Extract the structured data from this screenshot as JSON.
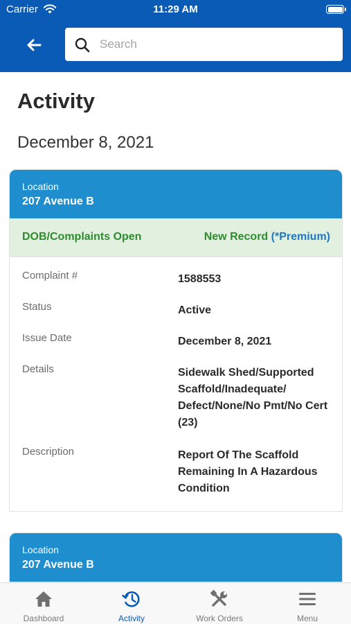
{
  "status_bar": {
    "carrier": "Carrier",
    "time": "11:29 AM"
  },
  "search": {
    "placeholder": "Search",
    "value": ""
  },
  "page": {
    "title": "Activity",
    "date": "December 8, 2021"
  },
  "cards": [
    {
      "location_label": "Location",
      "location": "207 Avenue B",
      "status_left": "DOB/Complaints Open",
      "status_right": "New Record",
      "premium": "(*Premium)",
      "fields": [
        {
          "label": "Complaint #",
          "value": "1588553"
        },
        {
          "label": "Status",
          "value": "Active"
        },
        {
          "label": "Issue Date",
          "value": "December 8, 2021"
        },
        {
          "label": "Details",
          "value": "Sidewalk Shed/Supported Scaffold/Inadequate/ Defect/None/No Pmt/No Cert (23)"
        },
        {
          "label": "Description",
          "value": "Report Of The Scaffold Remaining In A Hazardous Condition"
        }
      ]
    },
    {
      "location_label": "Location",
      "location": "207 Avenue B"
    }
  ],
  "tabs": [
    {
      "label": "Dashboard",
      "icon": "home-icon",
      "active": false
    },
    {
      "label": "Activity",
      "icon": "history-icon",
      "active": true
    },
    {
      "label": "Work Orders",
      "icon": "tools-icon",
      "active": false
    },
    {
      "label": "Menu",
      "icon": "hamburger-icon",
      "active": false
    }
  ],
  "colors": {
    "primary": "#0a5bb5",
    "card_header": "#1f8ecf",
    "status_bg": "#e2f0df",
    "status_green": "#2e8b2e",
    "premium_blue": "#1f77c2"
  }
}
